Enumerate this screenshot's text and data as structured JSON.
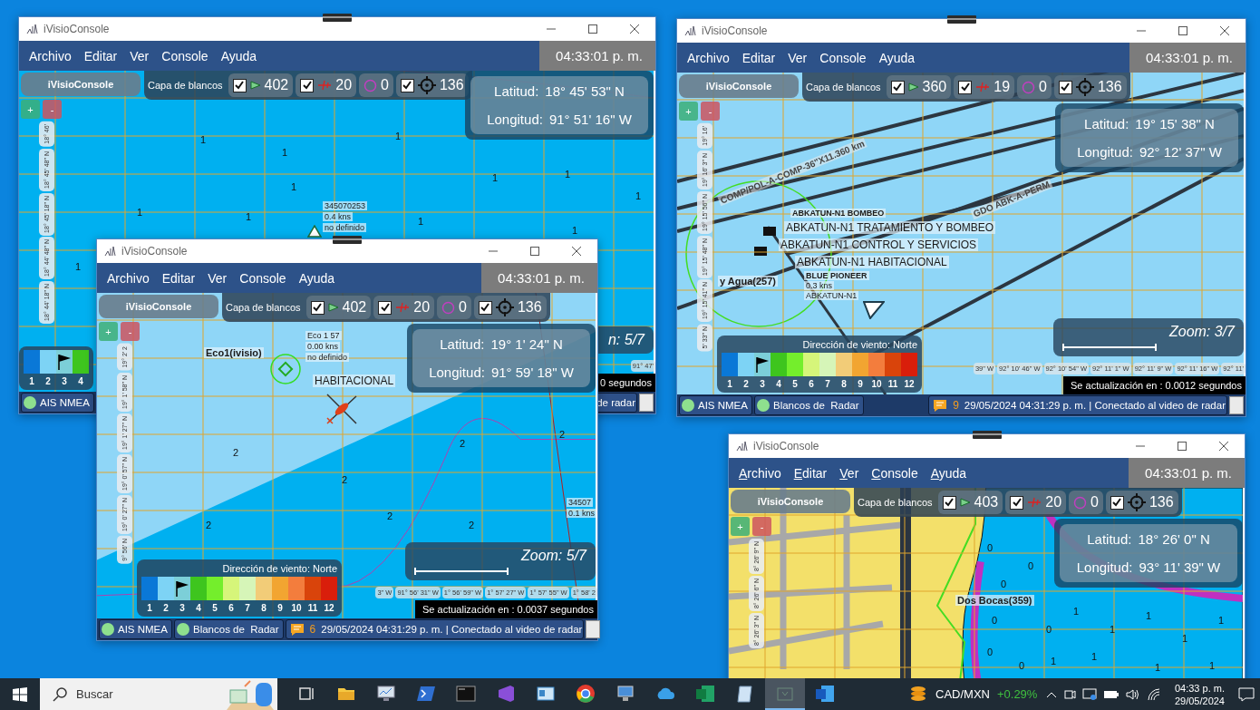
{
  "windows": [
    {
      "title": "iVisioConsole",
      "menu": [
        "Archivo",
        "Editar",
        "Ver",
        "Console",
        "Ayuda"
      ],
      "access_keys": false,
      "clock": "04:33:01 p. m.",
      "brand": "iVisioConsole",
      "zoom_in": "+",
      "zoom_out": "-",
      "layer_label": "Capa de blancos",
      "map": {
        "kind": "open-sea",
        "soundings": [
          "1",
          "1",
          "1",
          "1",
          "1",
          "1",
          "1",
          "1",
          "1",
          "1",
          "1",
          "1"
        ],
        "labels": [
          {
            "kind": "vessel",
            "text": "345070253"
          },
          {
            "kind": "vessel",
            "text": "0.4 kns"
          },
          {
            "kind": "vessel",
            "text": "no definido"
          }
        ]
      },
      "layers": [
        {
          "kind": "vessel",
          "checkbox": {
            "checked": true
          },
          "count": "402"
        },
        {
          "kind": "aircraft",
          "checkbox": {
            "checked": true
          },
          "count": "20"
        },
        {
          "kind": "ring",
          "count": "0"
        },
        {
          "kind": "target",
          "checkbox": {
            "checked": true
          },
          "count": "136"
        }
      ],
      "latitude": {
        "label": "Latitud:",
        "value": "18° 45' 53\" N"
      },
      "longitude": {
        "label": "Longitud:",
        "value": "91° 51' 16\" W"
      },
      "ruler": [
        "18° 46'",
        "18° 45' 48\" N",
        "18° 45' 18\" N",
        "18° 44' 48\" N",
        "18° 44' 18\" N"
      ],
      "wind": {
        "cells": [
          {
            "label": "1",
            "color": "#0a78d7",
            "selected": false
          },
          {
            "label": "2",
            "color": "#7dd3f5",
            "selected": false
          },
          {
            "label": "3",
            "color": "#7ccfd8",
            "selected": true
          },
          {
            "label": "4",
            "color": "#3ec51e",
            "selected": false
          }
        ]
      },
      "zoom": "n: 5/7",
      "scale_bar": false,
      "scale": [
        "91° 47'"
      ],
      "update": "0 segundos",
      "status": {
        "sensors": [
          "AIS NMEA"
        ],
        "message_text": "de radar"
      }
    },
    {
      "title": "iVisioConsole",
      "menu": [
        "Archivo",
        "Editar",
        "Ver",
        "Console",
        "Ayuda"
      ],
      "access_keys": false,
      "clock": "04:33:01 p. m.",
      "brand": "iVisioConsole",
      "zoom_in": "+",
      "zoom_out": "-",
      "layer_label": "Capa de blancos",
      "map": {
        "kind": "pipelines",
        "labels": [
          {
            "kind": "pipeline",
            "text": "COMP/POL-A-COMP-36\"X11.360 km"
          },
          {
            "kind": "pipeline",
            "text": "GDO ABK-A-PERM"
          },
          {
            "kind": "vessel-bold",
            "text": "ABKATUN-N1 BOMBEO"
          },
          {
            "kind": "platform",
            "text": "ABKATUN-N1 TRATAMIENTO Y BOMBEO"
          },
          {
            "kind": "platform",
            "text": "ABKATUN-N1 CONTROL Y SERVICIOS"
          },
          {
            "kind": "platform",
            "text": "ABKATUN-N1 HABITACIONAL"
          },
          {
            "kind": "vessel-bold",
            "text": "BLUE PIONEER"
          },
          {
            "kind": "vessel",
            "text": "0.3 kns"
          },
          {
            "kind": "vessel",
            "text": "ABKATUN-N1"
          },
          {
            "kind": "place",
            "text": "y Agua(257)"
          }
        ]
      },
      "layers": [
        {
          "kind": "vessel",
          "checkbox": {
            "checked": true
          },
          "count": "360"
        },
        {
          "kind": "aircraft",
          "checkbox": {
            "checked": true
          },
          "count": "19"
        },
        {
          "kind": "ring",
          "count": "0"
        },
        {
          "kind": "target",
          "checkbox": {
            "checked": true
          },
          "count": "136"
        }
      ],
      "latitude": {
        "label": "Latitud:",
        "value": "19° 15' 38\" N"
      },
      "longitude": {
        "label": "Longitud:",
        "value": "92° 12' 37\" W"
      },
      "ruler": [
        "19° 16'",
        "19° 16' 3\" N",
        "19° 15' 56\" N",
        "19° 15' 48\" N",
        "19° 15' 41\" N",
        "5' 33\" N"
      ],
      "wind": {
        "title": "Dirección de viento: Norte",
        "cells": [
          {
            "label": "1",
            "color": "#0a78d7",
            "selected": false
          },
          {
            "label": "2",
            "color": "#7dd3f5",
            "selected": false
          },
          {
            "label": "3",
            "color": "#7ccfd8",
            "selected": true
          },
          {
            "label": "4",
            "color": "#3ec51e",
            "selected": false
          },
          {
            "label": "5",
            "color": "#74ee2c",
            "selected": false
          },
          {
            "label": "6",
            "color": "#d6f57a",
            "selected": false
          },
          {
            "label": "7",
            "color": "#d6f5b8",
            "selected": false
          },
          {
            "label": "8",
            "color": "#f2cc78",
            "selected": false
          },
          {
            "label": "9",
            "color": "#f2a531",
            "selected": false
          },
          {
            "label": "10",
            "color": "#f37d3d",
            "selected": false
          },
          {
            "label": "11",
            "color": "#d9440b",
            "selected": false
          },
          {
            "label": "12",
            "color": "#d91e0b",
            "selected": false
          }
        ]
      },
      "zoom": "Zoom: 3/7",
      "scale_bar": true,
      "scale": [
        "39\" W",
        "92° 10' 46\" W",
        "92° 10' 54\" W",
        "92° 11' 1\" W",
        "92° 11' 9\" W",
        "92° 11' 16\" W",
        "92° 11'"
      ],
      "update": "Se actualización en : 0.0012 segundos",
      "status": {
        "sensors": [
          "AIS NMEA",
          "Blancos de  Radar"
        ],
        "messages": "9",
        "message_text": "29/05/2024 04:31:29 p. m. | Conectado al video de radar"
      }
    },
    {
      "title": "iVisioConsole",
      "menu": [
        "Archivo",
        "Editar",
        "Ver",
        "Console",
        "Ayuda"
      ],
      "access_keys": false,
      "clock": "04:33:01 p. m.",
      "brand": "iVisioConsole",
      "zoom_in": "+",
      "zoom_out": "-",
      "layer_label": "Capa de blancos",
      "map": {
        "kind": "coastal-shelf",
        "soundings": [
          "2",
          "2",
          "2",
          "2",
          "2",
          "2",
          "2"
        ],
        "labels": [
          {
            "kind": "place",
            "text": "Eco1(ivisio)"
          },
          {
            "kind": "vessel",
            "text": "Eco 1 57"
          },
          {
            "kind": "vessel",
            "text": "0.00 kns"
          },
          {
            "kind": "vessel",
            "text": "no definido"
          },
          {
            "kind": "platform",
            "text": "HABITACIONAL"
          },
          {
            "kind": "vessel",
            "text": "34507"
          },
          {
            "kind": "vessel",
            "text": "0.1 kns"
          }
        ]
      },
      "layers": [
        {
          "kind": "vessel",
          "checkbox": {
            "checked": true
          },
          "count": "402"
        },
        {
          "kind": "aircraft",
          "checkbox": {
            "checked": true
          },
          "count": "20"
        },
        {
          "kind": "ring",
          "count": "0"
        },
        {
          "kind": "target",
          "checkbox": {
            "checked": true
          },
          "count": "136"
        }
      ],
      "latitude": {
        "label": "Latitud:",
        "value": "19° 1' 24\" N"
      },
      "longitude": {
        "label": "Longitud:",
        "value": "91° 59' 18\" W"
      },
      "ruler": [
        "19° 2' 2",
        "19° 1' 58\" N",
        "19° 1' 27\" N",
        "19° 0' 57\" N",
        "19° 0' 27\" N",
        "9° 56' N"
      ],
      "wind": {
        "title": "Dirección de viento: Norte",
        "cells": [
          {
            "label": "1",
            "color": "#0a78d7",
            "selected": false
          },
          {
            "label": "2",
            "color": "#7dd3f5",
            "selected": false
          },
          {
            "label": "3",
            "color": "#7ccfd8",
            "selected": true
          },
          {
            "label": "4",
            "color": "#3ec51e",
            "selected": false
          },
          {
            "label": "5",
            "color": "#74ee2c",
            "selected": false
          },
          {
            "label": "6",
            "color": "#d6f57a",
            "selected": false
          },
          {
            "label": "7",
            "color": "#d6f5b8",
            "selected": false
          },
          {
            "label": "8",
            "color": "#f2cc78",
            "selected": false
          },
          {
            "label": "9",
            "color": "#f2a531",
            "selected": false
          },
          {
            "label": "10",
            "color": "#f37d3d",
            "selected": false
          },
          {
            "label": "11",
            "color": "#d9440b",
            "selected": false
          },
          {
            "label": "12",
            "color": "#d91e0b",
            "selected": false
          }
        ]
      },
      "zoom": "Zoom: 5/7",
      "scale_bar": true,
      "scale": [
        "3\" W",
        "91° 56' 31\" W",
        "1° 56' 59\" W",
        "1° 57' 27\" W",
        "1° 57' 55\" W",
        "1° 58' 2"
      ],
      "update": "Se actualización en : 0.0037 segundos",
      "status": {
        "sensors": [
          "AIS NMEA",
          "Blancos de  Radar"
        ],
        "messages": "6",
        "message_text": "29/05/2024 04:31:29 p. m. | Conectado al video de radar"
      }
    },
    {
      "title": "iVisioConsole",
      "menu": [
        "Archivo",
        "Editar",
        "Ver",
        "Console",
        "Ayuda"
      ],
      "access_keys": true,
      "clock": "04:33:01 p. m.",
      "brand": "iVisioConsole",
      "zoom_in": "+",
      "zoom_out": "-",
      "layer_label": "Capa de blancos",
      "map": {
        "kind": "harbor",
        "soundings": [
          "0",
          "0",
          "0",
          "0",
          "0",
          "0",
          "0",
          "1",
          "1",
          "1",
          "1",
          "1",
          "1",
          "1",
          "1",
          "1"
        ],
        "labels": [
          {
            "kind": "place",
            "text": "Dos Bocas(359)"
          }
        ]
      },
      "layers": [
        {
          "kind": "vessel",
          "checkbox": {
            "checked": true
          },
          "count": "403"
        },
        {
          "kind": "aircraft",
          "checkbox": {
            "checked": true
          },
          "count": "20"
        },
        {
          "kind": "ring",
          "count": "0"
        },
        {
          "kind": "target",
          "checkbox": {
            "checked": true
          },
          "count": "136"
        }
      ],
      "latitude": {
        "label": "Latitud:",
        "value": "18° 26' 0\" N"
      },
      "longitude": {
        "label": "Longitud:",
        "value": "93° 11' 39\" W"
      },
      "ruler": [
        "8° 26' 9\" N",
        "8° 26' 6\" N",
        "8° 26' 3\" N"
      ]
    }
  ],
  "taskbar": {
    "search_placeholder": "Buscar",
    "apps": [
      {
        "kind": "task-view",
        "active": false
      },
      {
        "kind": "folder",
        "active": false
      },
      {
        "kind": "monitor-chart",
        "active": false
      },
      {
        "kind": "shell",
        "active": false
      },
      {
        "kind": "terminal",
        "active": false
      },
      {
        "kind": "studio",
        "active": false
      },
      {
        "kind": "id-card",
        "active": false
      },
      {
        "kind": "browser",
        "active": false
      },
      {
        "kind": "remote",
        "active": false
      },
      {
        "kind": "cloud",
        "active": false
      },
      {
        "kind": "spreadsheet",
        "active": false
      },
      {
        "kind": "notepad",
        "active": false
      },
      {
        "kind": "diagram",
        "active": true
      },
      {
        "kind": "document",
        "active": false
      }
    ],
    "ticker": {
      "symbol": "CAD/MXN",
      "change": "+0.29%"
    },
    "time": "04:33 p. m.",
    "date": "29/05/2024"
  }
}
